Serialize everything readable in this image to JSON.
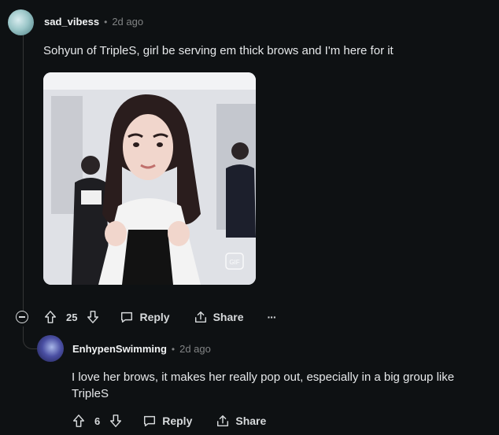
{
  "comment": {
    "username": "sad_vibess",
    "separator": "•",
    "time": "2d ago",
    "text": "Sohyun of TripleS, girl be serving em thick brows and I'm here for it",
    "media_badge": "GIF",
    "actions": {
      "votes": "25",
      "reply_label": "Reply",
      "share_label": "Share",
      "more_label": "···"
    }
  },
  "reply": {
    "username": "EnhypenSwimming",
    "separator": "•",
    "time": "2d ago",
    "text_line1": "I love her brows, it makes her really pop out, especially in a big group like",
    "text_line2": "TripleS",
    "actions": {
      "votes": "6",
      "reply_label": "Reply",
      "share_label": "Share"
    }
  },
  "colors": {
    "background": "#0e1113",
    "text": "#d7dadc",
    "muted": "#818384",
    "thread_line": "#343536"
  }
}
